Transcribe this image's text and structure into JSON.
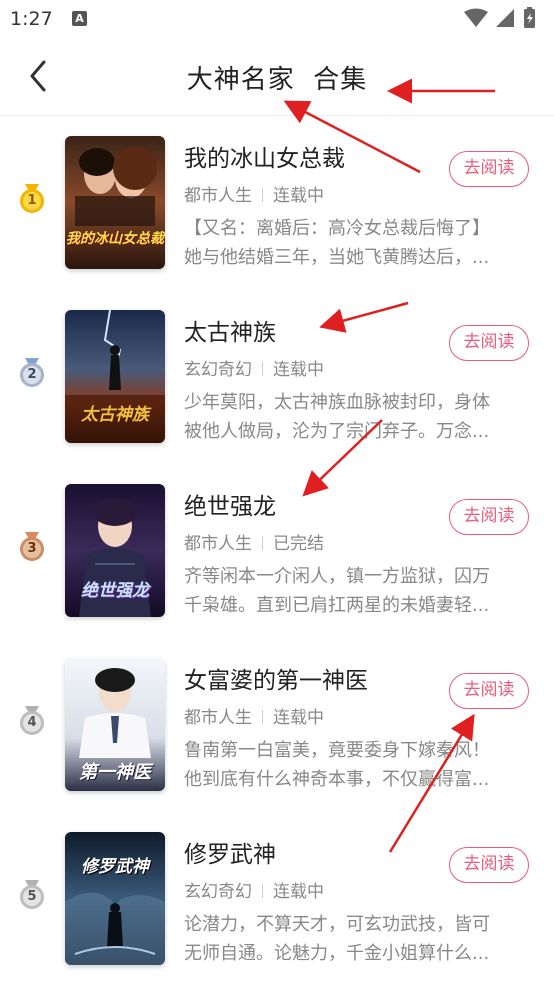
{
  "status": {
    "time": "1:27",
    "notification_icon": "A"
  },
  "nav": {
    "back_icon": "chevron-left-icon",
    "title": "大神名家  合集"
  },
  "colors": {
    "accent": "#ec5b7c",
    "annotation_arrow": "#e02020",
    "gold": "#f5b400",
    "silver": "#a8b4c4",
    "bronze": "#c8906a"
  },
  "books": [
    {
      "rank": "1",
      "title": "我的冰山女总裁",
      "category": "都市人生",
      "status": "连载中",
      "desc_lines": [
        "【又名：离婚后：高冷女总裁后悔了】",
        "她与他结婚三年，当她飞黄腾达后，..."
      ],
      "action": "去阅读",
      "cover_text": "我的冰山女总裁"
    },
    {
      "rank": "2",
      "title": "太古神族",
      "category": "玄幻奇幻",
      "status": "连载中",
      "desc_lines": [
        "少年莫阳，太古神族血脉被封印，身体",
        "被他人做局，沦为了宗门弃子。万念..."
      ],
      "action": "去阅读",
      "cover_text": "太古神族"
    },
    {
      "rank": "3",
      "title": "绝世强龙",
      "category": "都市人生",
      "status": "已完结",
      "desc_lines": [
        "齐等闲本一介闲人，镇一方监狱，囚万",
        "千枭雄。直到已肩扛两星的未婚妻轻..."
      ],
      "action": "去阅读",
      "cover_text": "绝世强龙"
    },
    {
      "rank": "4",
      "title": "女富婆的第一神医",
      "category": "都市人生",
      "status": "连载中",
      "desc_lines": [
        "鲁南第一白富美，竟要委身下嫁秦风！",
        "他到底有什么神奇本事，不仅赢得富..."
      ],
      "action": "去阅读",
      "cover_text": "第一神医"
    },
    {
      "rank": "5",
      "title": "修罗武神",
      "category": "玄幻奇幻",
      "status": "连载中",
      "desc_lines": [
        "论潜力，不算天才，可玄功武技，皆可",
        "无师自通。论魅力，千金小姐算什么..."
      ],
      "action": "去阅读",
      "cover_text": "修罗武神"
    }
  ]
}
